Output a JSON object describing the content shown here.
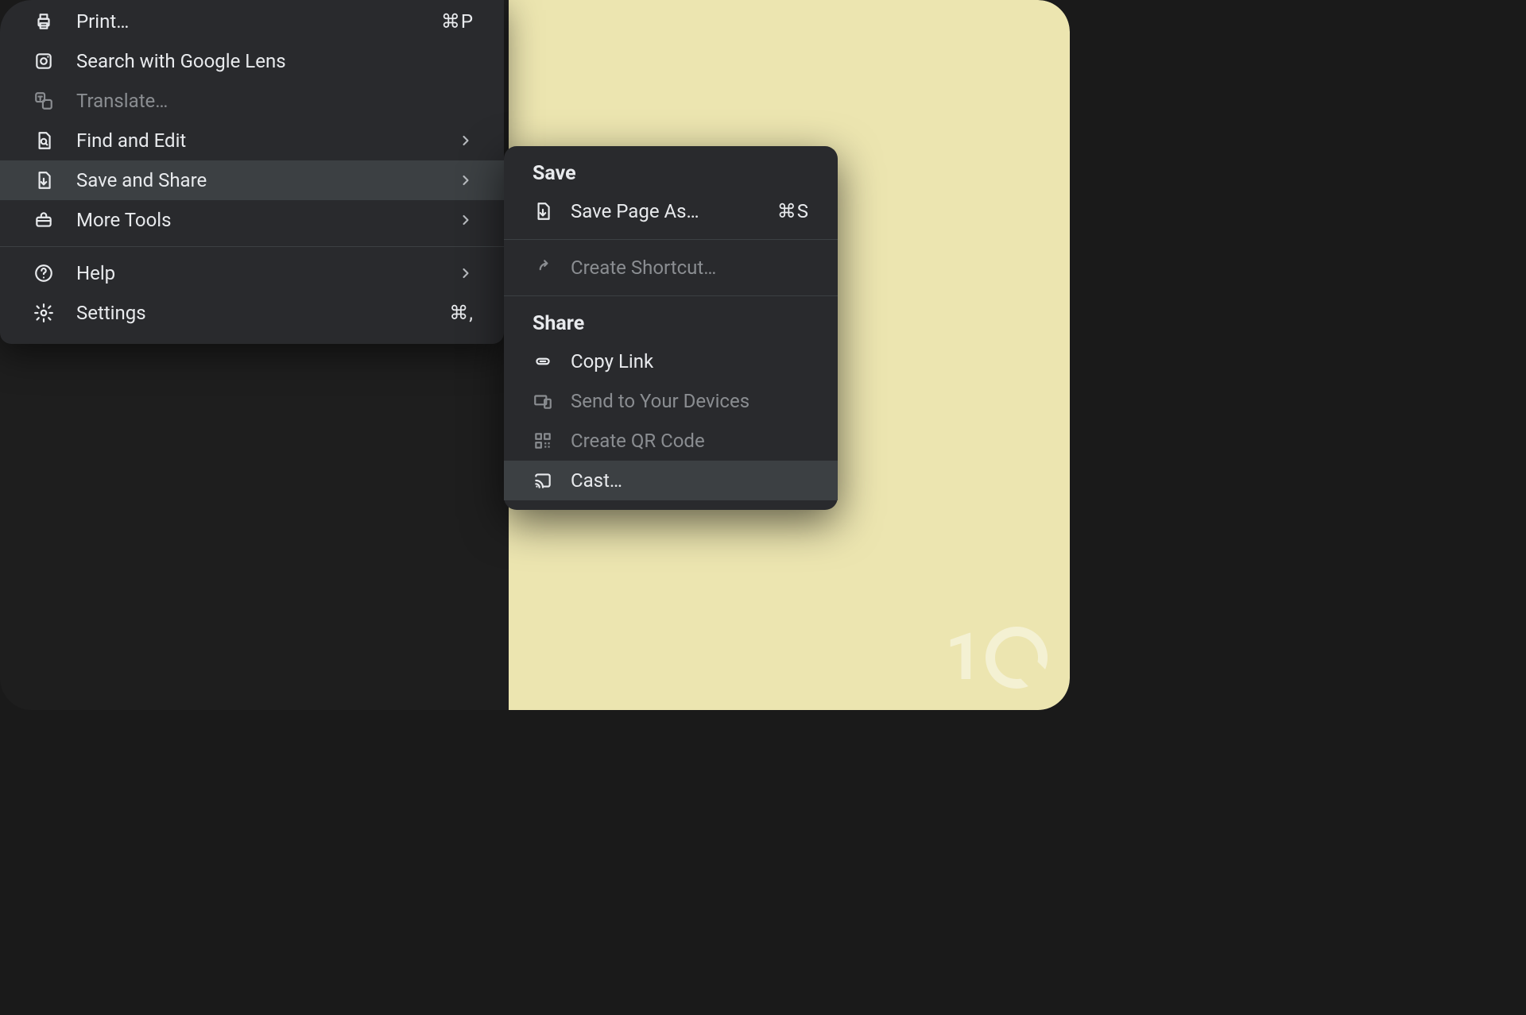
{
  "main_menu": {
    "items": [
      {
        "label": "Print…",
        "shortcut": "⌘P",
        "icon": "print",
        "disabled": false,
        "hasSubmenu": false
      },
      {
        "label": "Search with Google Lens",
        "shortcut": "",
        "icon": "lens",
        "disabled": false,
        "hasSubmenu": false
      },
      {
        "label": "Translate…",
        "shortcut": "",
        "icon": "translate",
        "disabled": true,
        "hasSubmenu": false
      },
      {
        "label": "Find and Edit",
        "shortcut": "",
        "icon": "find",
        "disabled": false,
        "hasSubmenu": true
      },
      {
        "label": "Save and Share",
        "shortcut": "",
        "icon": "save",
        "disabled": false,
        "hasSubmenu": true,
        "hovered": true
      },
      {
        "label": "More Tools",
        "shortcut": "",
        "icon": "toolbox",
        "disabled": false,
        "hasSubmenu": true
      },
      {
        "separator": true
      },
      {
        "label": "Help",
        "shortcut": "",
        "icon": "help",
        "disabled": false,
        "hasSubmenu": true
      },
      {
        "label": "Settings",
        "shortcut": "⌘,",
        "icon": "settings",
        "disabled": false,
        "hasSubmenu": false
      }
    ]
  },
  "submenu": {
    "sections": [
      {
        "header": "Save",
        "items": [
          {
            "label": "Save Page As…",
            "shortcut": "⌘S",
            "icon": "save",
            "disabled": false
          },
          {
            "separator": true
          },
          {
            "label": "Create Shortcut…",
            "shortcut": "",
            "icon": "shortcut",
            "disabled": true
          }
        ]
      },
      {
        "header": "Share",
        "items": [
          {
            "label": "Copy Link",
            "shortcut": "",
            "icon": "link",
            "disabled": false
          },
          {
            "label": "Send to Your Devices",
            "shortcut": "",
            "icon": "devices",
            "disabled": true
          },
          {
            "label": "Create QR Code",
            "shortcut": "",
            "icon": "qr",
            "disabled": true
          },
          {
            "label": "Cast…",
            "shortcut": "",
            "icon": "cast",
            "disabled": false,
            "hovered": true
          }
        ]
      }
    ]
  },
  "watermark": {
    "text": "1"
  }
}
